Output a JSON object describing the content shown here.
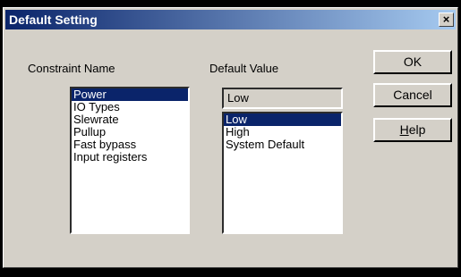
{
  "window": {
    "title": "Default Setting",
    "close_glyph": "×"
  },
  "labels": {
    "constraint_name": "Constraint Name",
    "default_value": "Default Value"
  },
  "constraint_list": [
    "Power",
    "IO Types",
    "Slewrate",
    "Pullup",
    "Fast bypass",
    "Input registers"
  ],
  "current_value": "Low",
  "value_list": [
    "Low",
    "High",
    "System Default"
  ],
  "buttons": {
    "ok": "OK",
    "cancel": "Cancel",
    "help_mnemonic": "H",
    "help_rest": "elp"
  }
}
